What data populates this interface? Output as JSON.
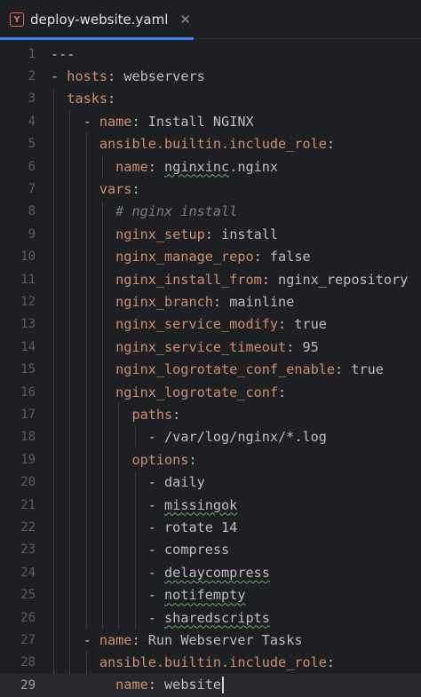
{
  "tab": {
    "icon_letter": "Y",
    "title": "deploy-website.yaml",
    "close_glyph": "✕"
  },
  "editor": {
    "current_line": 29,
    "lines": [
      {
        "num": "1",
        "code": "---"
      },
      {
        "num": "2",
        "code": "- hosts: webservers"
      },
      {
        "num": "3",
        "code": "  tasks:"
      },
      {
        "num": "4",
        "code": "    - name: Install NGINX"
      },
      {
        "num": "5",
        "code": "      ansible.builtin.include_role:"
      },
      {
        "num": "6",
        "code": "        name: nginxinc.nginx"
      },
      {
        "num": "7",
        "code": "      vars:"
      },
      {
        "num": "8",
        "code": "        # nginx install"
      },
      {
        "num": "9",
        "code": "        nginx_setup: install"
      },
      {
        "num": "10",
        "code": "        nginx_manage_repo: false"
      },
      {
        "num": "11",
        "code": "        nginx_install_from: nginx_repository"
      },
      {
        "num": "12",
        "code": "        nginx_branch: mainline"
      },
      {
        "num": "13",
        "code": "        nginx_service_modify: true"
      },
      {
        "num": "14",
        "code": "        nginx_service_timeout: 95"
      },
      {
        "num": "15",
        "code": "        nginx_logrotate_conf_enable: true"
      },
      {
        "num": "16",
        "code": "        nginx_logrotate_conf:"
      },
      {
        "num": "17",
        "code": "          paths:"
      },
      {
        "num": "18",
        "code": "            - /var/log/nginx/*.log"
      },
      {
        "num": "19",
        "code": "          options:"
      },
      {
        "num": "20",
        "code": "            - daily"
      },
      {
        "num": "21",
        "code": "            - missingok"
      },
      {
        "num": "22",
        "code": "            - rotate 14"
      },
      {
        "num": "23",
        "code": "            - compress"
      },
      {
        "num": "24",
        "code": "            - delaycompress"
      },
      {
        "num": "25",
        "code": "            - notifempty"
      },
      {
        "num": "26",
        "code": "            - sharedscripts"
      },
      {
        "num": "27",
        "code": "    - name: Run Webserver Tasks"
      },
      {
        "num": "28",
        "code": "      ansible.builtin.include_role:"
      },
      {
        "num": "29",
        "code": "        name: website"
      }
    ],
    "spellcheck_words": [
      "nginxinc",
      "missingok",
      "delaycompress",
      "notifempty",
      "sharedscripts"
    ],
    "colors": {
      "background": "#1e1f22",
      "key": "#cf8e6d",
      "value": "#bcbec4",
      "comment": "#7a7e85",
      "tab_underline": "#3d7ff3",
      "current_line": "#26282e"
    }
  }
}
